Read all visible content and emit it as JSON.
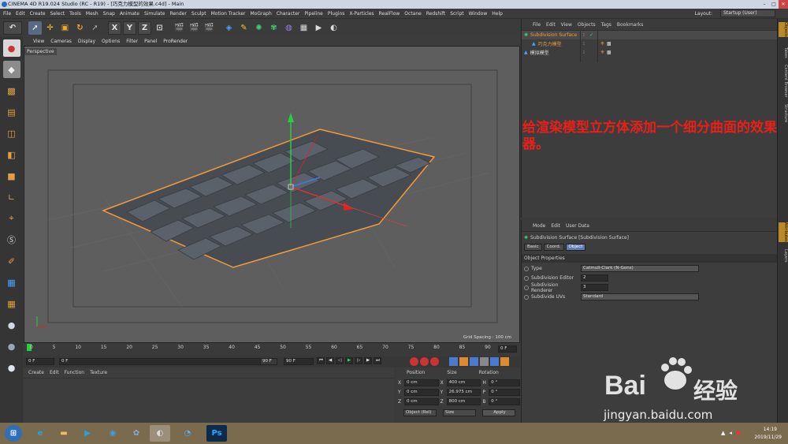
{
  "window": {
    "title": "CINEMA 4D R19.024 Studio (RC - R19) - [巧克力模型的效果.c4d] - Main"
  },
  "menubar": {
    "items": [
      "File",
      "Edit",
      "Create",
      "Select",
      "Tools",
      "Mesh",
      "Snap",
      "Animate",
      "Simulate",
      "Render",
      "Sculpt",
      "Motion Tracker",
      "MoGraph",
      "Character",
      "Pipeline",
      "Plugins",
      "X-Particles",
      "RealFlow",
      "Octane",
      "Redshift",
      "Script",
      "Window",
      "Help"
    ],
    "layout_label": "Layout:",
    "layout_value": "Startup (User)"
  },
  "toolbar": {
    "axis_x": "X",
    "axis_y": "Y",
    "axis_z": "Z"
  },
  "viewport": {
    "menu": [
      "View",
      "Cameras",
      "Display",
      "Options",
      "Filter",
      "Panel",
      "ProRender"
    ],
    "label": "Perspective",
    "grid_spacing": "Grid Spacing : 100 cm"
  },
  "timeline": {
    "ticks": [
      "0",
      "5",
      "10",
      "15",
      "20",
      "25",
      "30",
      "35",
      "40",
      "45",
      "50",
      "55",
      "60",
      "65",
      "70",
      "75",
      "80",
      "85",
      "90"
    ],
    "frame_end": "0 F"
  },
  "transport": {
    "start": "0 F",
    "current": "0 F",
    "max1": "90 F",
    "max2": "90 F"
  },
  "material": {
    "menu": [
      "Create",
      "Edit",
      "Function",
      "Texture"
    ]
  },
  "coords": {
    "headers": [
      "Position",
      "Size",
      "Rotation"
    ],
    "rows": [
      {
        "axis": "X",
        "pos": "0 cm",
        "saxis": "X",
        "size": "400 cm",
        "raxis": "H",
        "rot": "0 °"
      },
      {
        "axis": "Y",
        "pos": "0 cm",
        "saxis": "Y",
        "size": "26.975 cm",
        "raxis": "P",
        "rot": "0 °"
      },
      {
        "axis": "Z",
        "pos": "0 cm",
        "saxis": "Z",
        "size": "800 cm",
        "raxis": "B",
        "rot": "0 °"
      }
    ],
    "mode": "Object (Rel)",
    "size_mode": "Size",
    "apply": "Apply"
  },
  "objects": {
    "menu": [
      "File",
      "Edit",
      "View",
      "Objects",
      "Tags",
      "Bookmarks"
    ],
    "items": [
      {
        "name": "Subdivision Surface",
        "level": 0
      },
      {
        "name": "巧克力模型",
        "level": 1
      },
      {
        "name": "模拟模型",
        "level": 0
      }
    ]
  },
  "attributes": {
    "menu": [
      "Mode",
      "Edit",
      "User Data"
    ],
    "header": "Subdivision Surface [Subdivision Surface]",
    "tabs": [
      "Basic",
      "Coord.",
      "Object"
    ],
    "section": "Object Properties",
    "props": [
      {
        "label": "Type",
        "value": "Catmull-Clark (N-Gons)"
      },
      {
        "label": "Subdivision Editor",
        "value": "2"
      },
      {
        "label": "Subdivision Renderer",
        "value": "3"
      },
      {
        "label": "Subdivide UVs",
        "value": "Standard"
      }
    ]
  },
  "side_tabs": [
    "Objects",
    "Takes",
    "Content Browser",
    "Structure",
    "Attributes",
    "Layers"
  ],
  "annotation": "给渲染模型立方体添加一个细分曲面的效果器。",
  "watermark": {
    "brand": "Bai",
    "brand2": "经验",
    "url": "jingyan.baidu.com"
  },
  "taskbar": {
    "time": "14:19",
    "date": "2019/11/29"
  },
  "colors": {
    "accent": "#e8201a",
    "selected": "#f39c3a",
    "bg": "#3a3a3a"
  }
}
